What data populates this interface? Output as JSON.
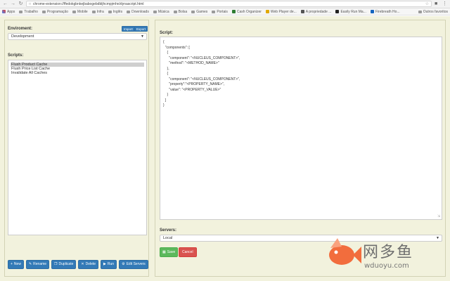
{
  "browser": {
    "url": "chrome-extension://ffedokgbnkejbabogebdbljhcmpjmhn/dynascript.html",
    "bookmarks": [
      {
        "label": "Apps",
        "type": "apps"
      },
      {
        "label": "Trabalho",
        "type": "folder"
      },
      {
        "label": "Programação",
        "type": "folder"
      },
      {
        "label": "Mobile",
        "type": "folder"
      },
      {
        "label": "Infra",
        "type": "folder"
      },
      {
        "label": "Inglês",
        "type": "folder"
      },
      {
        "label": "Downloads",
        "type": "folder"
      },
      {
        "label": "Música",
        "type": "folder"
      },
      {
        "label": "Bolsa",
        "type": "folder"
      },
      {
        "label": "Games",
        "type": "folder"
      },
      {
        "label": "Portais",
        "type": "folder"
      },
      {
        "label": "Cash Organizer",
        "type": "site",
        "color": "#2f7d32"
      },
      {
        "label": "Web Player de...",
        "type": "site",
        "color": "#e0a800"
      },
      {
        "label": "A propriedade ...",
        "type": "site",
        "color": "#555555"
      },
      {
        "label": "Easily Run Ma...",
        "type": "site",
        "color": "#222222"
      },
      {
        "label": "Firebreath Ho...",
        "type": "site",
        "color": "#1565c0"
      }
    ],
    "other_bookmarks": "Outros favoritos"
  },
  "environment": {
    "label": "Enviroment:",
    "import_label": "Import",
    "export_label": "Export",
    "selected": "Development"
  },
  "scripts": {
    "label": "Scripts:",
    "items": [
      {
        "label": "Flush Product Cache",
        "selected": true
      },
      {
        "label": "Flush Price List Cache",
        "selected": false
      },
      {
        "label": "Invalidate All Caches",
        "selected": false
      }
    ],
    "buttons": {
      "new": "New",
      "rename": "Rename",
      "duplicate": "Duplicate",
      "delete": "Delete",
      "run": "Run",
      "edit_servers": "Edit Servers"
    }
  },
  "script_editor": {
    "label": "Script:",
    "lines": [
      "{",
      "  \"components\": [",
      "    {",
      "      \"component\": \"<NUCLEUS_COMPONENT>\",",
      "      \"method\": \"<METHOD_NAME>\"",
      "    },",
      "    {",
      "      \"component\": \"<NUCLEUS_COMPONENT>\",",
      "      \"property\":\"<PROPERTY_NAME>\",",
      "      \"value\": \"<PROPERTY_VALUE>\"",
      "    }",
      "  ]",
      "}"
    ]
  },
  "servers": {
    "label": "Servers:",
    "selected": "Local"
  },
  "actions": {
    "save": "Save",
    "cancel": "Cancel"
  },
  "watermark": {
    "cn": "网多鱼",
    "domain": "wduoyu.com"
  }
}
